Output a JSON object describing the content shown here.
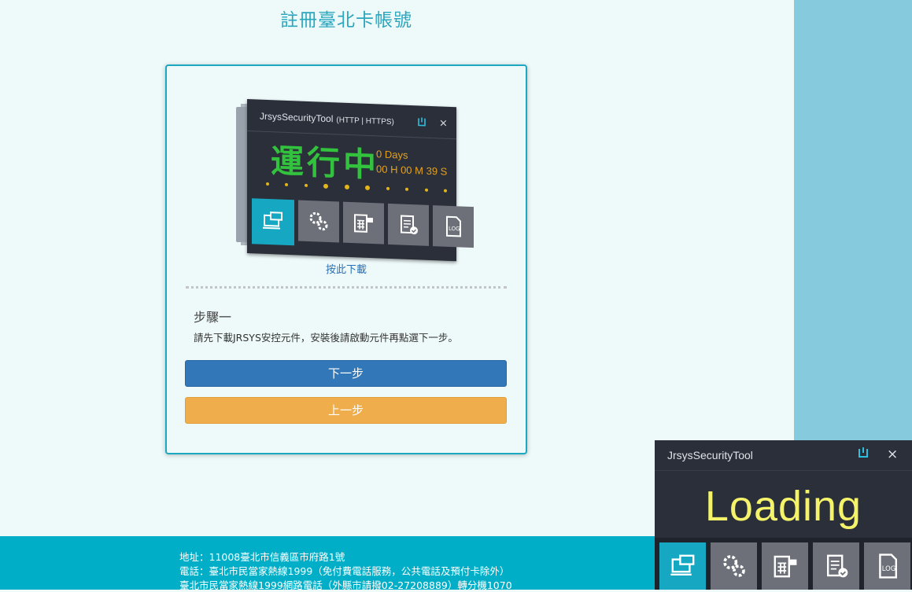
{
  "page": {
    "title": "註冊臺北卡帳號"
  },
  "illustration": {
    "title": "JrsysSecurityTool",
    "protocols": "(HTTP | HTTPS)",
    "status": "運行中",
    "days": "0 Days",
    "time": "00 H 00 M 39 S",
    "pin_icon": "pin-icon",
    "close": "×"
  },
  "card": {
    "download_link": "按此下載",
    "step_title": "步驟一",
    "step_desc": "請先下載JRSYS安控元件，安裝後請啟動元件再點選下一步。",
    "next_label": "下一步",
    "prev_label": "上一步"
  },
  "footer": {
    "address": "地址：11008臺北市信義區市府路1號",
    "phone": "電話：臺北市民當家熱線1999（免付費電話服務，公共電話及預付卡除外）",
    "web_phone": "臺北市民當家熱線1999網路電話（外縣市請撥02-27208889）轉分機1070"
  },
  "widget": {
    "title": "JrsysSecurityTool",
    "status": "Loading",
    "close": "×",
    "icons": [
      "monitor-chat-icon",
      "gears-icon",
      "calculator-card-icon",
      "checklist-icon",
      "log-file-icon"
    ]
  },
  "colors": {
    "accent": "#00afc7",
    "primary_button": "#3277b8",
    "secondary_button": "#efae4b",
    "running_green": "#33c23d",
    "loading_yellow": "#f4f36a",
    "tool_bg": "#2b2f3a"
  }
}
